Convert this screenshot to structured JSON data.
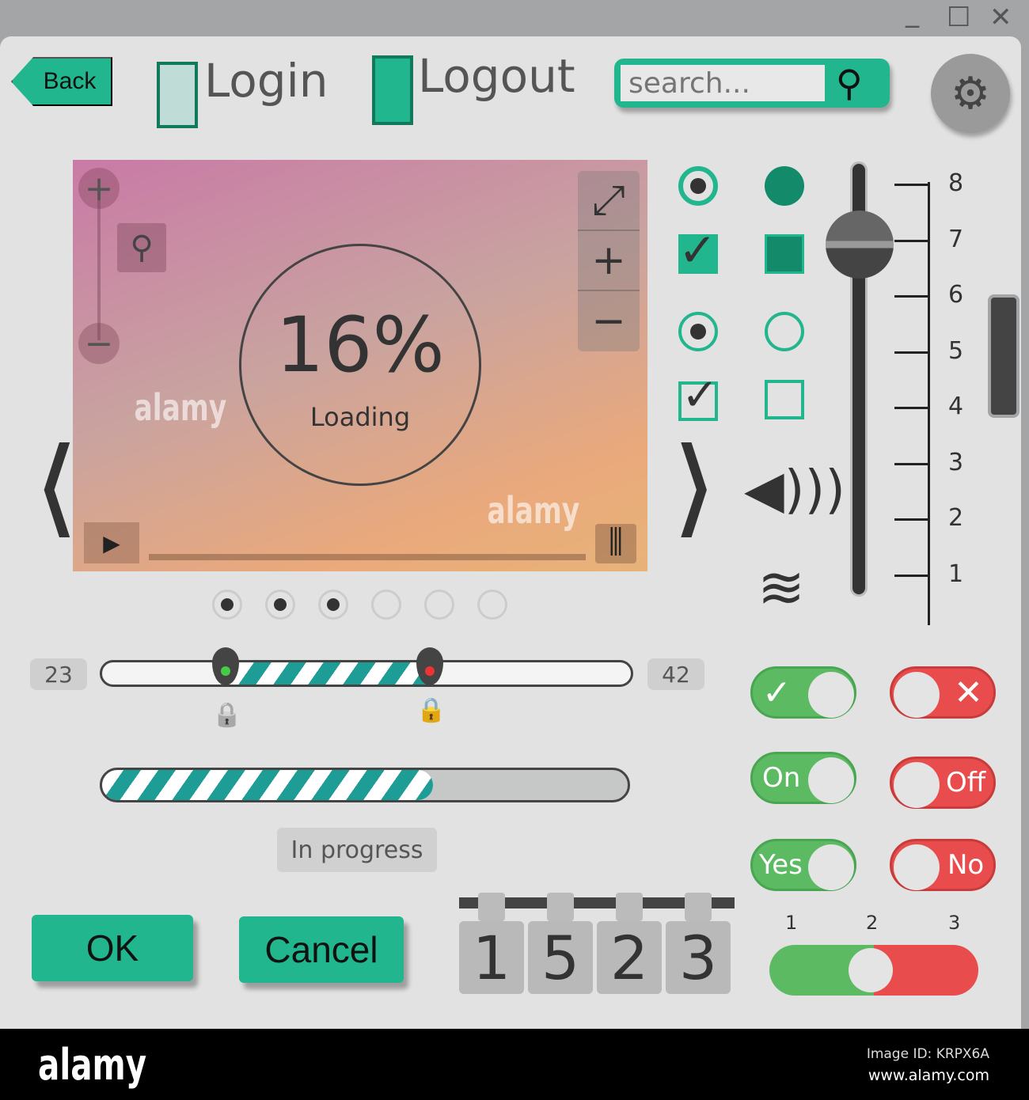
{
  "window_controls": {
    "minimize": "_",
    "maximize": "☐",
    "close": "✕"
  },
  "header": {
    "back": "Back",
    "login": "Login",
    "logout": "Logout",
    "search_placeholder": "search...",
    "search_icon": "⚲",
    "settings_icon": "⚙"
  },
  "player": {
    "zoom_in": "+",
    "zoom_out": "−",
    "percent": "16%",
    "status": "Loading",
    "fullscreen": "⤢",
    "plus": "+",
    "minus": "−",
    "play": "▶",
    "equalizer": "⫼",
    "prev": "❮",
    "next": "❯"
  },
  "pager": {
    "total": 6,
    "active": 3
  },
  "controls": {
    "speaker": "🔊",
    "wifi": "📶"
  },
  "volume": {
    "ticks": [
      "8",
      "7",
      "6",
      "5",
      "4",
      "3",
      "2",
      "1"
    ],
    "value": 7
  },
  "range": {
    "min": "23",
    "max": "42",
    "lock": "🔒"
  },
  "progress": {
    "value": 0.63,
    "label": "In progress"
  },
  "buttons": {
    "ok": "OK",
    "cancel": "Cancel"
  },
  "counter": {
    "digits": [
      "1",
      "5",
      "2",
      "3"
    ]
  },
  "toggles": {
    "check": "✓",
    "cross": "✕",
    "on": "On",
    "off": "Off",
    "yes": "Yes",
    "no": "No"
  },
  "tri_switch": {
    "labels": [
      "1",
      "2",
      "3"
    ],
    "value": 2
  },
  "colors": {
    "teal": "#22b68e",
    "green": "#5cba62",
    "red": "#e84c4c"
  },
  "footer": {
    "brand": "alamy",
    "image_id": "Image ID: KRPX6A",
    "url": "www.alamy.com"
  }
}
